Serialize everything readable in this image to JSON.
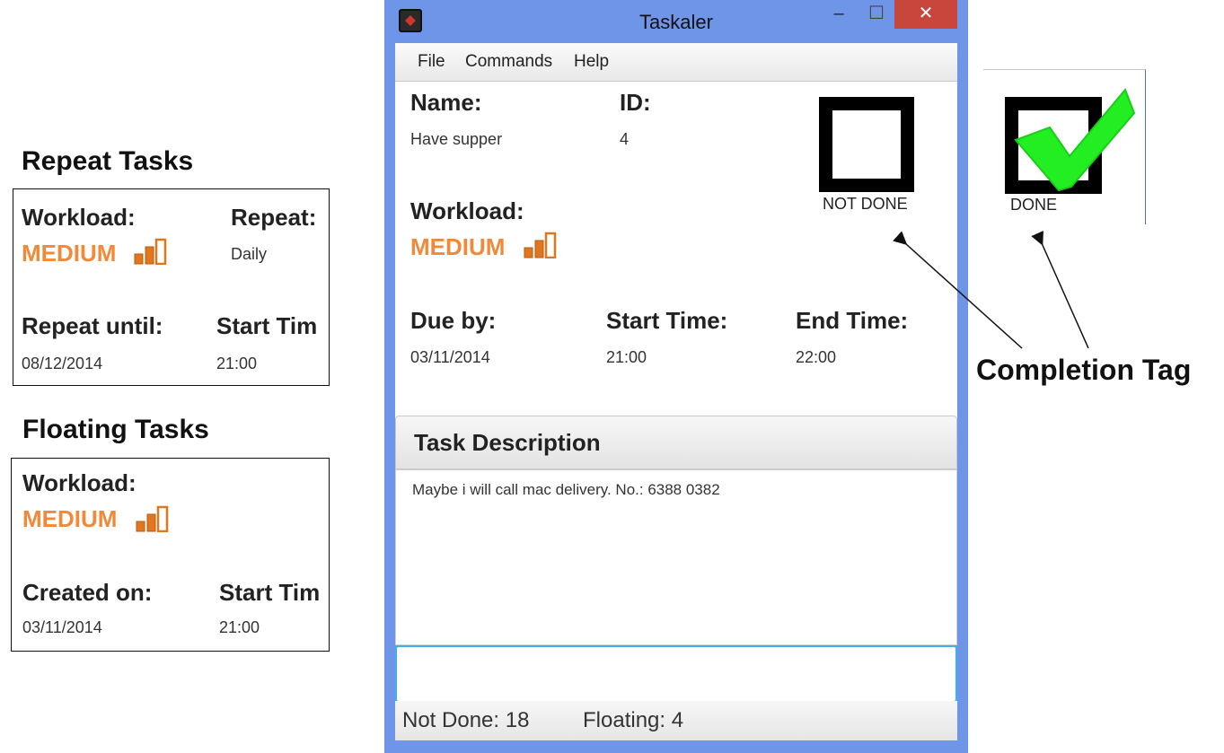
{
  "repeat_card": {
    "heading": "Repeat Tasks",
    "workload_label": "Workload:",
    "workload_value": "MEDIUM",
    "repeat_label": "Repeat:",
    "repeat_value": "Daily",
    "repeat_until_label": "Repeat until:",
    "repeat_until_value": "08/12/2014",
    "start_time_label": "Start Tim",
    "start_time_value": "21:00"
  },
  "floating_card": {
    "heading": "Floating Tasks",
    "workload_label": "Workload:",
    "workload_value": "MEDIUM",
    "created_label": "Created on:",
    "created_value": "03/11/2014",
    "start_time_label": "Start Tim",
    "start_time_value": "21:00"
  },
  "window": {
    "title": "Taskaler",
    "controls": {
      "minimize": "–",
      "maximize": "☐",
      "close": "✕"
    },
    "menu": [
      "File",
      "Commands",
      "Help"
    ],
    "task": {
      "name_label": "Name:",
      "name_value": "Have supper",
      "id_label": "ID:",
      "id_value": "4",
      "workload_label": "Workload:",
      "workload_value": "MEDIUM",
      "due_label": "Due by:",
      "due_value": "03/11/2014",
      "start_label": "Start Time:",
      "start_value": "21:00",
      "end_label": "End Time:",
      "end_value": "22:00",
      "completion_tag": "NOT DONE"
    },
    "description_header": "Task Description",
    "description_text": "Maybe i will call mac delivery. No.: 6388 0382",
    "command_input_value": "",
    "status": {
      "not_done": "Not Done: 18",
      "floating": "Floating: 4"
    }
  },
  "annotation": {
    "done_label": "DONE",
    "completion_label": "Completion Tag"
  },
  "colors": {
    "workload_orange": "#f08a3a",
    "window_frame": "#6f95e8",
    "close_button": "#c9463d",
    "check_green": "#22ee22",
    "input_focus": "#3eb2e8"
  },
  "icons": [
    "workload-bars-icon",
    "app-icon",
    "checkbox-empty-icon",
    "checkmark-icon",
    "arrow-icon"
  ]
}
